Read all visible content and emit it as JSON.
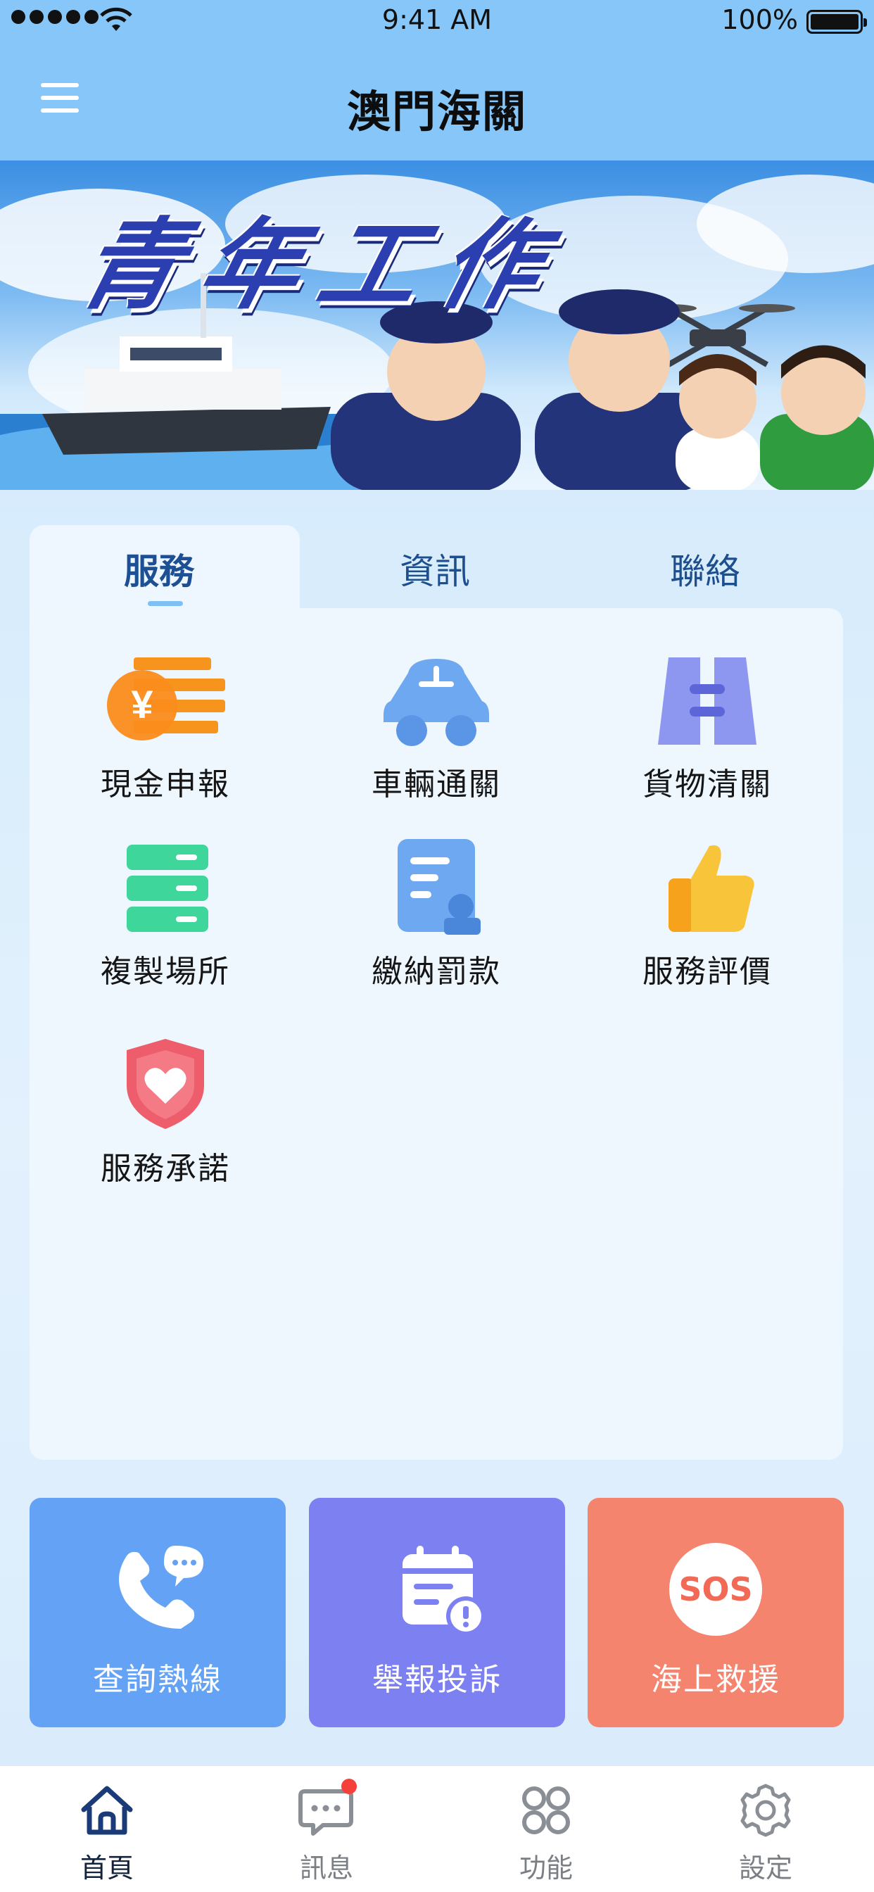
{
  "status_bar": {
    "time": "9:41 AM",
    "battery": "100%"
  },
  "header": {
    "title": "澳門海關",
    "menu_icon": "hamburger-menu-icon"
  },
  "banner": {
    "headline": "青年工作"
  },
  "tabs": [
    {
      "label": "服務",
      "active": true
    },
    {
      "label": "資訊",
      "active": false
    },
    {
      "label": "聯絡",
      "active": false
    }
  ],
  "services": [
    {
      "label": "現金申報",
      "icon": "cash-declaration-icon",
      "color": "#f7941d"
    },
    {
      "label": "車輛通關",
      "icon": "vehicle-icon",
      "color": "#6ea8f0"
    },
    {
      "label": "貨物清關",
      "icon": "cargo-icon",
      "color": "#8d97ef"
    },
    {
      "label": "複製場所",
      "icon": "server-icon",
      "color": "#3ed69b"
    },
    {
      "label": "繳納罰款",
      "icon": "document-user-icon",
      "color": "#6ea8f0"
    },
    {
      "label": "服務評價",
      "icon": "thumbs-up-icon",
      "color": "#f8c53a"
    },
    {
      "label": "服務承諾",
      "icon": "heart-shield-icon",
      "color": "#ee5d6c"
    }
  ],
  "quick_actions": [
    {
      "label": "查詢熱線",
      "icon": "phone-chat-icon",
      "color": "#64a2f5"
    },
    {
      "label": "舉報投訴",
      "icon": "calendar-alert-icon",
      "color": "#7d80f1"
    },
    {
      "label": "海上救援",
      "icon": "sos-icon",
      "color": "#f5846f",
      "badge_text": "SOS"
    }
  ],
  "tab_bar": [
    {
      "label": "首頁",
      "icon": "home-icon",
      "active": true
    },
    {
      "label": "訊息",
      "icon": "message-icon",
      "active": false,
      "has_badge": true
    },
    {
      "label": "功能",
      "icon": "features-icon",
      "active": false
    },
    {
      "label": "設定",
      "icon": "settings-icon",
      "active": false
    }
  ]
}
